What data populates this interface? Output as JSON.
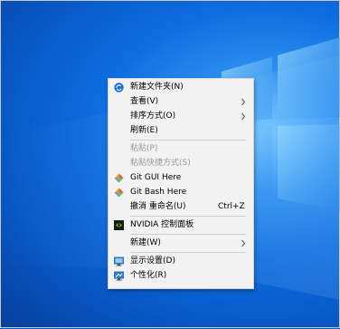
{
  "menu": {
    "items": [
      {
        "label": "新建文件夹(N)",
        "icon": "sync-icon"
      },
      {
        "label": "查看(V)",
        "submenu": true
      },
      {
        "label": "排序方式(O)",
        "submenu": true
      },
      {
        "label": "刷新(E)"
      },
      {
        "label": "粘贴(P)",
        "disabled": true
      },
      {
        "label": "粘贴快捷方式(S)",
        "disabled": true
      },
      {
        "label": "Git GUI Here",
        "icon": "git-icon"
      },
      {
        "label": "Git Bash Here",
        "icon": "git-icon"
      },
      {
        "label": "撤消 重命名(U)",
        "shortcut": "Ctrl+Z"
      },
      {
        "label": "NVIDIA 控制面板",
        "icon": "nvidia-icon"
      },
      {
        "label": "新建(W)",
        "submenu": true
      },
      {
        "label": "显示设置(D)",
        "icon": "display-settings-icon"
      },
      {
        "label": "个性化(R)",
        "icon": "personalize-icon"
      }
    ]
  },
  "colors": {
    "desktop": "#0d6de0",
    "menu_bg": "#f2f2f2",
    "disabled_text": "#9a9a9a",
    "nvidia_green": "#76b900"
  }
}
